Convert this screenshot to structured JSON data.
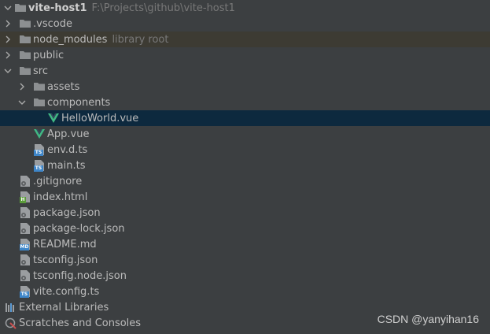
{
  "project": {
    "name": "vite-host1",
    "path": "F:\\Projects\\github\\vite-host1"
  },
  "tree": {
    "vscode": ".vscode",
    "node_modules": "node_modules",
    "node_modules_hint": "library root",
    "public": "public",
    "src": "src",
    "assets": "assets",
    "components": "components",
    "helloworld": "HelloWorld.vue",
    "app": "App.vue",
    "envd": "env.d.ts",
    "main": "main.ts",
    "gitignore": ".gitignore",
    "index": "index.html",
    "package": "package.json",
    "package_lock": "package-lock.json",
    "readme": "README.md",
    "tsconfig": "tsconfig.json",
    "tsconfig_node": "tsconfig.node.json",
    "viteconfig": "vite.config.ts",
    "external": "External Libraries",
    "scratches": "Scratches and Consoles"
  },
  "badges": {
    "ts": "TS",
    "html": "H",
    "md": "MD"
  },
  "watermark": "CSDN @yanyihan16",
  "colors": {
    "selection": "#0d293e",
    "library_row": "#3d3b33",
    "folder": "#8c8f91",
    "vue": "#41b883",
    "ts_badge": "#3e86c9"
  }
}
